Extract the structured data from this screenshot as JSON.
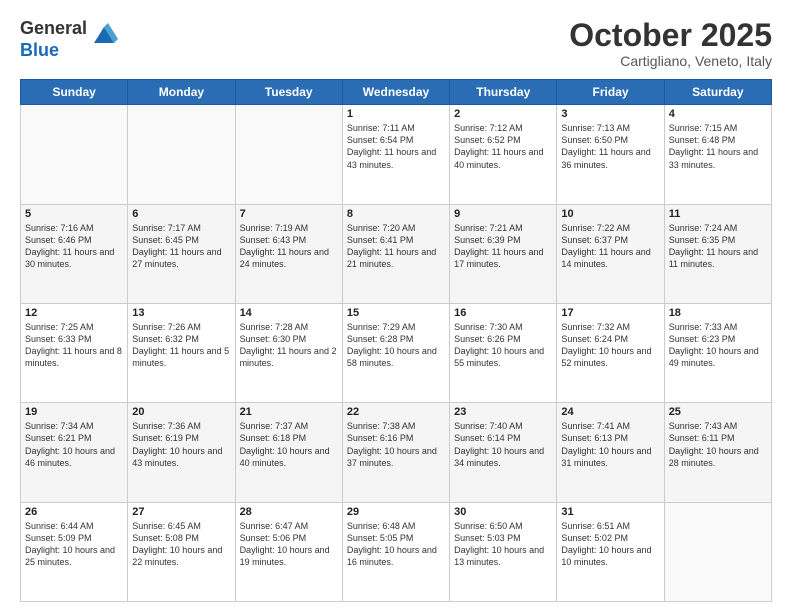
{
  "logo": {
    "general": "General",
    "blue": "Blue"
  },
  "header": {
    "month": "October 2025",
    "location": "Cartigliano, Veneto, Italy"
  },
  "days_of_week": [
    "Sunday",
    "Monday",
    "Tuesday",
    "Wednesday",
    "Thursday",
    "Friday",
    "Saturday"
  ],
  "weeks": [
    [
      {
        "day": "",
        "info": ""
      },
      {
        "day": "",
        "info": ""
      },
      {
        "day": "",
        "info": ""
      },
      {
        "day": "1",
        "info": "Sunrise: 7:11 AM\nSunset: 6:54 PM\nDaylight: 11 hours and 43 minutes."
      },
      {
        "day": "2",
        "info": "Sunrise: 7:12 AM\nSunset: 6:52 PM\nDaylight: 11 hours and 40 minutes."
      },
      {
        "day": "3",
        "info": "Sunrise: 7:13 AM\nSunset: 6:50 PM\nDaylight: 11 hours and 36 minutes."
      },
      {
        "day": "4",
        "info": "Sunrise: 7:15 AM\nSunset: 6:48 PM\nDaylight: 11 hours and 33 minutes."
      }
    ],
    [
      {
        "day": "5",
        "info": "Sunrise: 7:16 AM\nSunset: 6:46 PM\nDaylight: 11 hours and 30 minutes."
      },
      {
        "day": "6",
        "info": "Sunrise: 7:17 AM\nSunset: 6:45 PM\nDaylight: 11 hours and 27 minutes."
      },
      {
        "day": "7",
        "info": "Sunrise: 7:19 AM\nSunset: 6:43 PM\nDaylight: 11 hours and 24 minutes."
      },
      {
        "day": "8",
        "info": "Sunrise: 7:20 AM\nSunset: 6:41 PM\nDaylight: 11 hours and 21 minutes."
      },
      {
        "day": "9",
        "info": "Sunrise: 7:21 AM\nSunset: 6:39 PM\nDaylight: 11 hours and 17 minutes."
      },
      {
        "day": "10",
        "info": "Sunrise: 7:22 AM\nSunset: 6:37 PM\nDaylight: 11 hours and 14 minutes."
      },
      {
        "day": "11",
        "info": "Sunrise: 7:24 AM\nSunset: 6:35 PM\nDaylight: 11 hours and 11 minutes."
      }
    ],
    [
      {
        "day": "12",
        "info": "Sunrise: 7:25 AM\nSunset: 6:33 PM\nDaylight: 11 hours and 8 minutes."
      },
      {
        "day": "13",
        "info": "Sunrise: 7:26 AM\nSunset: 6:32 PM\nDaylight: 11 hours and 5 minutes."
      },
      {
        "day": "14",
        "info": "Sunrise: 7:28 AM\nSunset: 6:30 PM\nDaylight: 11 hours and 2 minutes."
      },
      {
        "day": "15",
        "info": "Sunrise: 7:29 AM\nSunset: 6:28 PM\nDaylight: 10 hours and 58 minutes."
      },
      {
        "day": "16",
        "info": "Sunrise: 7:30 AM\nSunset: 6:26 PM\nDaylight: 10 hours and 55 minutes."
      },
      {
        "day": "17",
        "info": "Sunrise: 7:32 AM\nSunset: 6:24 PM\nDaylight: 10 hours and 52 minutes."
      },
      {
        "day": "18",
        "info": "Sunrise: 7:33 AM\nSunset: 6:23 PM\nDaylight: 10 hours and 49 minutes."
      }
    ],
    [
      {
        "day": "19",
        "info": "Sunrise: 7:34 AM\nSunset: 6:21 PM\nDaylight: 10 hours and 46 minutes."
      },
      {
        "day": "20",
        "info": "Sunrise: 7:36 AM\nSunset: 6:19 PM\nDaylight: 10 hours and 43 minutes."
      },
      {
        "day": "21",
        "info": "Sunrise: 7:37 AM\nSunset: 6:18 PM\nDaylight: 10 hours and 40 minutes."
      },
      {
        "day": "22",
        "info": "Sunrise: 7:38 AM\nSunset: 6:16 PM\nDaylight: 10 hours and 37 minutes."
      },
      {
        "day": "23",
        "info": "Sunrise: 7:40 AM\nSunset: 6:14 PM\nDaylight: 10 hours and 34 minutes."
      },
      {
        "day": "24",
        "info": "Sunrise: 7:41 AM\nSunset: 6:13 PM\nDaylight: 10 hours and 31 minutes."
      },
      {
        "day": "25",
        "info": "Sunrise: 7:43 AM\nSunset: 6:11 PM\nDaylight: 10 hours and 28 minutes."
      }
    ],
    [
      {
        "day": "26",
        "info": "Sunrise: 6:44 AM\nSunset: 5:09 PM\nDaylight: 10 hours and 25 minutes."
      },
      {
        "day": "27",
        "info": "Sunrise: 6:45 AM\nSunset: 5:08 PM\nDaylight: 10 hours and 22 minutes."
      },
      {
        "day": "28",
        "info": "Sunrise: 6:47 AM\nSunset: 5:06 PM\nDaylight: 10 hours and 19 minutes."
      },
      {
        "day": "29",
        "info": "Sunrise: 6:48 AM\nSunset: 5:05 PM\nDaylight: 10 hours and 16 minutes."
      },
      {
        "day": "30",
        "info": "Sunrise: 6:50 AM\nSunset: 5:03 PM\nDaylight: 10 hours and 13 minutes."
      },
      {
        "day": "31",
        "info": "Sunrise: 6:51 AM\nSunset: 5:02 PM\nDaylight: 10 hours and 10 minutes."
      },
      {
        "day": "",
        "info": ""
      }
    ]
  ]
}
